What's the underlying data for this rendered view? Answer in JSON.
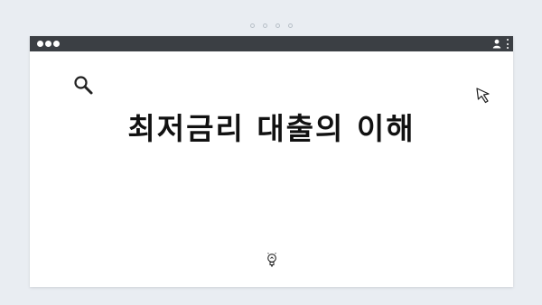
{
  "window": {
    "title_bar_controls": [
      "window-dot",
      "window-dot",
      "window-dot"
    ]
  },
  "main": {
    "headline": "최저금리 대출의 이해"
  },
  "icons": {
    "search": "search-icon",
    "cursor": "cursor-icon",
    "user": "user-icon",
    "menu": "kebab-menu-icon",
    "bulb": "lightbulb-icon"
  },
  "colors": {
    "background": "#e9edf2",
    "titlebar": "#3b3f44",
    "text": "#111111"
  }
}
